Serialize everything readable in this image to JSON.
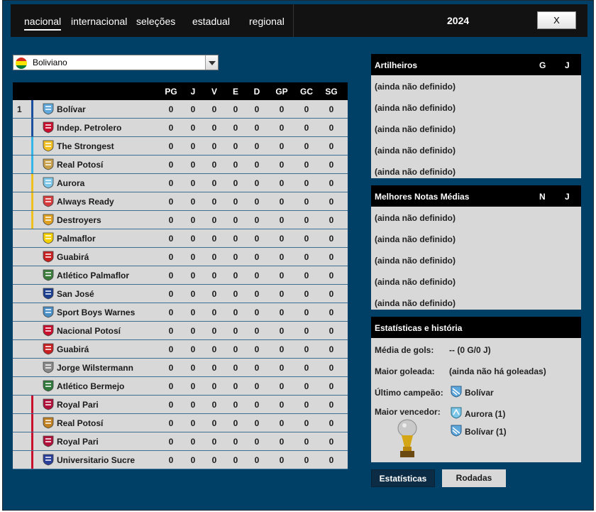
{
  "nav": {
    "tabs": [
      "nacional",
      "internacional",
      "seleções",
      "estadual",
      "regional"
    ],
    "active_tab": "nacional",
    "year": "2024",
    "close_label": "X"
  },
  "competition_select": {
    "value": "Boliviano",
    "flag_colors": [
      "#d52b1e",
      "#f9e300",
      "#007934"
    ]
  },
  "table": {
    "headers": [
      "PG",
      "J",
      "V",
      "E",
      "D",
      "GP",
      "GC",
      "SG"
    ],
    "rows": [
      {
        "pos": "1",
        "team": "Bolívar",
        "crest": "bolivar-crest-icon",
        "zone": "#1d4fa0",
        "stats": [
          "0",
          "0",
          "0",
          "0",
          "0",
          "0",
          "0",
          "0"
        ]
      },
      {
        "pos": "",
        "team": "Indep. Petrolero",
        "crest": "petrolero-crest-icon",
        "zone": "#1d4fa0",
        "stats": [
          "0",
          "0",
          "0",
          "0",
          "0",
          "0",
          "0",
          "0"
        ]
      },
      {
        "pos": "",
        "team": "The Strongest",
        "crest": "strongest-crest-icon",
        "zone": "#35b6e8",
        "stats": [
          "0",
          "0",
          "0",
          "0",
          "0",
          "0",
          "0",
          "0"
        ]
      },
      {
        "pos": "",
        "team": "Real Potosí",
        "crest": "real-potosi-crest-icon",
        "zone": "#35b6e8",
        "stats": [
          "0",
          "0",
          "0",
          "0",
          "0",
          "0",
          "0",
          "0"
        ]
      },
      {
        "pos": "",
        "team": "Aurora",
        "crest": "aurora-crest-icon",
        "zone": "#f0c020",
        "stats": [
          "0",
          "0",
          "0",
          "0",
          "0",
          "0",
          "0",
          "0"
        ]
      },
      {
        "pos": "",
        "team": "Always Ready",
        "crest": "always-ready-crest-icon",
        "zone": "#f0c020",
        "stats": [
          "0",
          "0",
          "0",
          "0",
          "0",
          "0",
          "0",
          "0"
        ]
      },
      {
        "pos": "",
        "team": "Destroyers",
        "crest": "destroyers-crest-icon",
        "zone": "#f0c020",
        "stats": [
          "0",
          "0",
          "0",
          "0",
          "0",
          "0",
          "0",
          "0"
        ]
      },
      {
        "pos": "",
        "team": "Palmaflor",
        "crest": "palmaflor-crest-icon",
        "zone": "",
        "stats": [
          "0",
          "0",
          "0",
          "0",
          "0",
          "0",
          "0",
          "0"
        ]
      },
      {
        "pos": "",
        "team": "Guabirá",
        "crest": "guabira-crest-icon",
        "zone": "",
        "stats": [
          "0",
          "0",
          "0",
          "0",
          "0",
          "0",
          "0",
          "0"
        ]
      },
      {
        "pos": "",
        "team": "Atlético Palmaflor",
        "crest": "atletico-palmaflor-crest-icon",
        "zone": "",
        "stats": [
          "0",
          "0",
          "0",
          "0",
          "0",
          "0",
          "0",
          "0"
        ]
      },
      {
        "pos": "",
        "team": "San José",
        "crest": "san-jose-crest-icon",
        "zone": "",
        "stats": [
          "0",
          "0",
          "0",
          "0",
          "0",
          "0",
          "0",
          "0"
        ]
      },
      {
        "pos": "",
        "team": "Sport Boys Warnes",
        "crest": "sport-boys-crest-icon",
        "zone": "",
        "stats": [
          "0",
          "0",
          "0",
          "0",
          "0",
          "0",
          "0",
          "0"
        ]
      },
      {
        "pos": "",
        "team": "Nacional Potosí",
        "crest": "nacional-potosi-crest-icon",
        "zone": "",
        "stats": [
          "0",
          "0",
          "0",
          "0",
          "0",
          "0",
          "0",
          "0"
        ]
      },
      {
        "pos": "",
        "team": "Guabirá",
        "crest": "guabira-crest-icon",
        "zone": "",
        "stats": [
          "0",
          "0",
          "0",
          "0",
          "0",
          "0",
          "0",
          "0"
        ]
      },
      {
        "pos": "",
        "team": "Jorge Wilstermann",
        "crest": "wilstermann-crest-icon",
        "zone": "",
        "stats": [
          "0",
          "0",
          "0",
          "0",
          "0",
          "0",
          "0",
          "0"
        ]
      },
      {
        "pos": "",
        "team": "Atlético Bermejo",
        "crest": "bermejo-crest-icon",
        "zone": "",
        "stats": [
          "0",
          "0",
          "0",
          "0",
          "0",
          "0",
          "0",
          "0"
        ]
      },
      {
        "pos": "",
        "team": "Royal Pari",
        "crest": "royal-pari-crest-icon",
        "zone": "#c8102e",
        "stats": [
          "0",
          "0",
          "0",
          "0",
          "0",
          "0",
          "0",
          "0"
        ]
      },
      {
        "pos": "",
        "team": "Real Potosí",
        "crest": "real-potosi-crest-icon",
        "zone": "#c8102e",
        "stats": [
          "0",
          "0",
          "0",
          "0",
          "0",
          "0",
          "0",
          "0"
        ]
      },
      {
        "pos": "",
        "team": "Royal Pari",
        "crest": "royal-pari-crest-icon",
        "zone": "#c8102e",
        "stats": [
          "0",
          "0",
          "0",
          "0",
          "0",
          "0",
          "0",
          "0"
        ]
      },
      {
        "pos": "",
        "team": "Universitario Sucre",
        "crest": "universitario-sucre-crest-icon",
        "zone": "#c8102e",
        "stats": [
          "0",
          "0",
          "0",
          "0",
          "0",
          "0",
          "0",
          "0"
        ]
      }
    ]
  },
  "scorers": {
    "title": "Artilheiros",
    "col_g": "G",
    "col_j": "J",
    "rows": [
      "(ainda não definido)",
      "(ainda não definido)",
      "(ainda não definido)",
      "(ainda não definido)",
      "(ainda não definido)"
    ]
  },
  "ratings": {
    "title": "Melhores Notas Médias",
    "col_n": "N",
    "col_j": "J",
    "rows": [
      "(ainda não definido)",
      "(ainda não definido)",
      "(ainda não definido)",
      "(ainda não definido)",
      "(ainda não definido)"
    ]
  },
  "stats": {
    "title": "Estatísticas e história",
    "avg_goals_label": "Média de gols:",
    "avg_goals_value": "-- (0 G/0 J)",
    "biggest_win_label": "Maior goleada:",
    "biggest_win_value": "(ainda não há goleadas)",
    "last_champion_label": "Último campeão:",
    "last_champion_value": "Bolívar",
    "top_winner_label": "Maior vencedor:",
    "top_winners": [
      "Aurora (1)",
      "Bolívar (1)"
    ]
  },
  "bottom_tabs": {
    "stats_label": "Estatísticas",
    "rounds_label": "Rodadas"
  },
  "colors": {
    "background": "#003f66",
    "header": "#000000",
    "row": "#d8d8d8"
  }
}
